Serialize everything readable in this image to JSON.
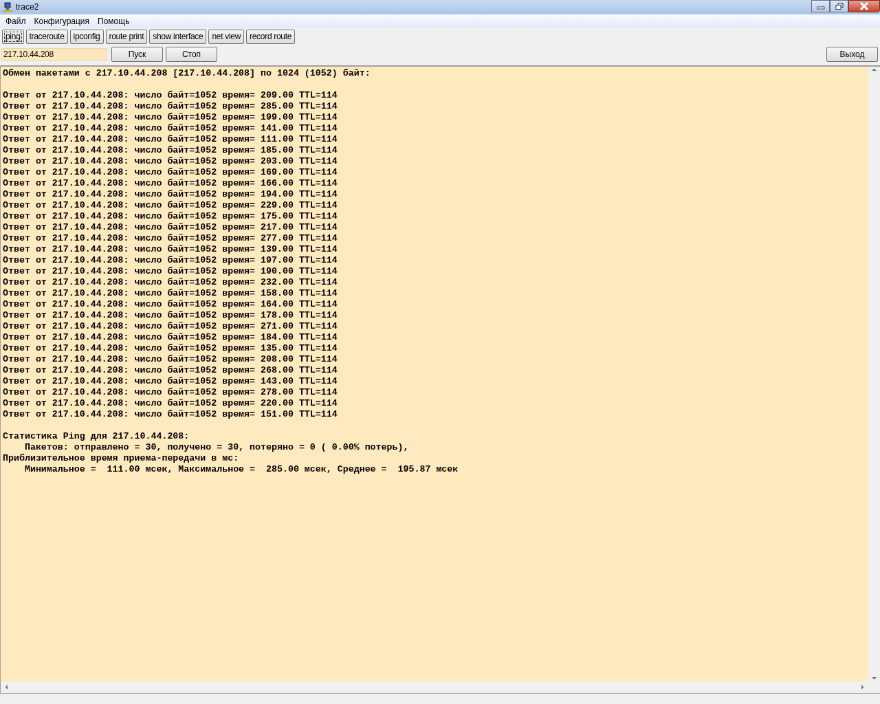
{
  "window": {
    "title": "trace2"
  },
  "menu": [
    "Файл",
    "Конфигурация",
    "Помощь"
  ],
  "tools": [
    {
      "label": "ping",
      "selected": true
    },
    {
      "label": "traceroute",
      "selected": false
    },
    {
      "label": "ipconfig",
      "selected": false
    },
    {
      "label": "route print",
      "selected": false
    },
    {
      "label": "show interface",
      "selected": false
    },
    {
      "label": "net view",
      "selected": false
    },
    {
      "label": "record route",
      "selected": false
    }
  ],
  "host_field": {
    "value": "217.10.44.208"
  },
  "buttons": [
    "Пуск",
    "Стоп"
  ],
  "exit_button": "Выход",
  "output": {
    "header": "Обмен пакетами с 217.10.44.208 [217.10.44.208] по 1024 (1052) байт:",
    "replies": [
      "Ответ от 217.10.44.208: число байт=1052 время= 209.00 TTL=114",
      "Ответ от 217.10.44.208: число байт=1052 время= 285.00 TTL=114",
      "Ответ от 217.10.44.208: число байт=1052 время= 199.00 TTL=114",
      "Ответ от 217.10.44.208: число байт=1052 время= 141.00 TTL=114",
      "Ответ от 217.10.44.208: число байт=1052 время= 111.00 TTL=114",
      "Ответ от 217.10.44.208: число байт=1052 время= 185.00 TTL=114",
      "Ответ от 217.10.44.208: число байт=1052 время= 203.00 TTL=114",
      "Ответ от 217.10.44.208: число байт=1052 время= 169.00 TTL=114",
      "Ответ от 217.10.44.208: число байт=1052 время= 166.00 TTL=114",
      "Ответ от 217.10.44.208: число байт=1052 время= 194.00 TTL=114",
      "Ответ от 217.10.44.208: число байт=1052 время= 229.00 TTL=114",
      "Ответ от 217.10.44.208: число байт=1052 время= 175.00 TTL=114",
      "Ответ от 217.10.44.208: число байт=1052 время= 217.00 TTL=114",
      "Ответ от 217.10.44.208: число байт=1052 время= 277.00 TTL=114",
      "Ответ от 217.10.44.208: число байт=1052 время= 139.00 TTL=114",
      "Ответ от 217.10.44.208: число байт=1052 время= 197.00 TTL=114",
      "Ответ от 217.10.44.208: число байт=1052 время= 190.00 TTL=114",
      "Ответ от 217.10.44.208: число байт=1052 время= 232.00 TTL=114",
      "Ответ от 217.10.44.208: число байт=1052 время= 158.00 TTL=114",
      "Ответ от 217.10.44.208: число байт=1052 время= 164.00 TTL=114",
      "Ответ от 217.10.44.208: число байт=1052 время= 178.00 TTL=114",
      "Ответ от 217.10.44.208: число байт=1052 время= 271.00 TTL=114",
      "Ответ от 217.10.44.208: число байт=1052 время= 184.00 TTL=114",
      "Ответ от 217.10.44.208: число байт=1052 время= 135.00 TTL=114",
      "Ответ от 217.10.44.208: число байт=1052 время= 208.00 TTL=114",
      "Ответ от 217.10.44.208: число байт=1052 время= 268.00 TTL=114",
      "Ответ от 217.10.44.208: число байт=1052 время= 143.00 TTL=114",
      "Ответ от 217.10.44.208: число байт=1052 время= 278.00 TTL=114",
      "Ответ от 217.10.44.208: число байт=1052 время= 220.00 TTL=114",
      "Ответ от 217.10.44.208: число байт=1052 время= 151.00 TTL=114"
    ],
    "statistics": [
      "Статистика Ping для 217.10.44.208:",
      "    Пакетов: отправлено = 30, получено = 30, потеряно = 0 ( 0.00% потерь),",
      "Приблизительное время приема-передачи в мс:",
      "    Минимальное =  111.00 мсек, Максимальное =  285.00 мсек, Среднее =  195.87 мсек"
    ]
  }
}
